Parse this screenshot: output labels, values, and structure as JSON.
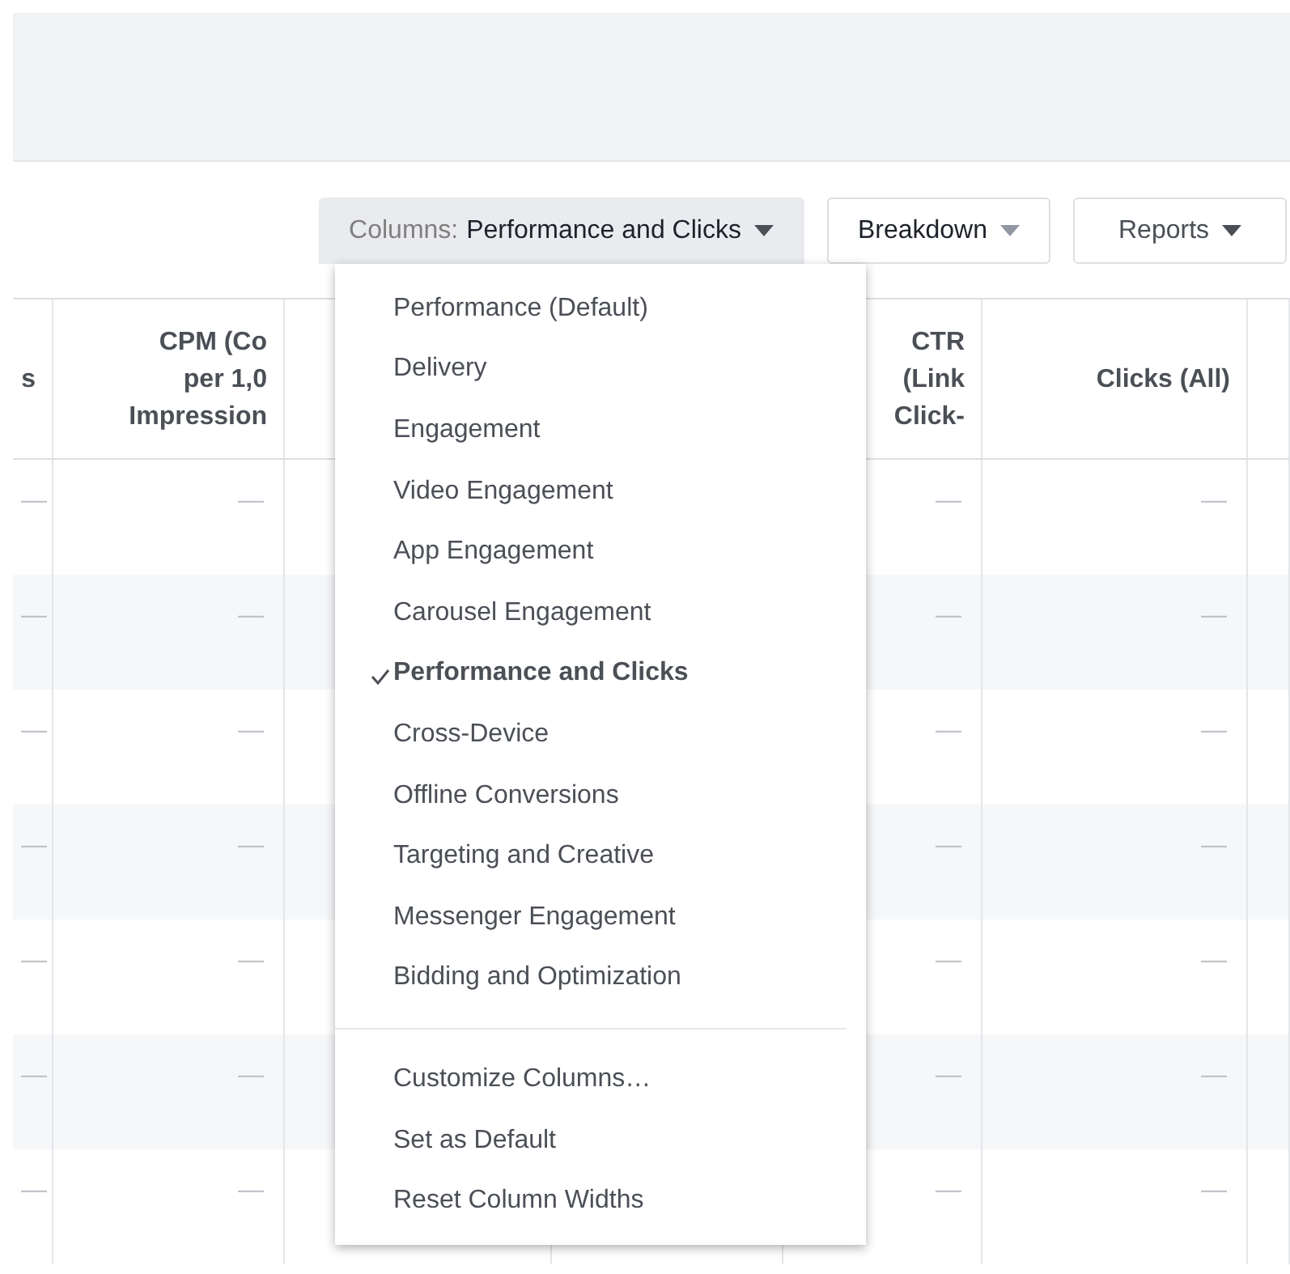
{
  "toolbar": {
    "columns_button": {
      "label": "Columns:",
      "value": "Performance and Clicks"
    },
    "buttons": [
      {
        "label": "Breakdown",
        "kind": "light"
      },
      {
        "label": "Reports",
        "kind": "dark"
      }
    ]
  },
  "table": {
    "columns": [
      "s",
      "CPM (Co\nper 1,0\nImpression",
      "CTR\n(Link\nClick-",
      "Clicks (All)"
    ],
    "rows": [
      {
        "cells": [
          "—",
          "—",
          "—",
          "—"
        ]
      },
      {
        "cells": [
          "—",
          "—",
          "—",
          "—"
        ]
      },
      {
        "cells": [
          "—",
          "—",
          "—",
          "—"
        ]
      },
      {
        "cells": [
          "—",
          "—",
          "—",
          "—"
        ]
      },
      {
        "cells": [
          "—",
          "—",
          "—",
          "—"
        ]
      },
      {
        "cells": [
          "—",
          "—",
          "—",
          "—"
        ]
      },
      {
        "cells": [
          "—",
          "—",
          "—",
          "—"
        ]
      }
    ]
  },
  "menu": {
    "options": [
      {
        "label": "Performance (Default)",
        "selected": false
      },
      {
        "label": "Delivery",
        "selected": false
      },
      {
        "label": "Engagement",
        "selected": false
      },
      {
        "label": "Video Engagement",
        "selected": false
      },
      {
        "label": "App Engagement",
        "selected": false
      },
      {
        "label": "Carousel Engagement",
        "selected": false
      },
      {
        "label": "Performance and Clicks",
        "selected": true
      },
      {
        "label": "Cross-Device",
        "selected": false
      },
      {
        "label": "Offline Conversions",
        "selected": false
      },
      {
        "label": "Targeting and Creative",
        "selected": false
      },
      {
        "label": "Messenger Engagement",
        "selected": false
      },
      {
        "label": "Bidding and Optimization",
        "selected": false
      }
    ],
    "actions": [
      "Customize Columns…",
      "Set as Default",
      "Reset Column Widths"
    ]
  }
}
